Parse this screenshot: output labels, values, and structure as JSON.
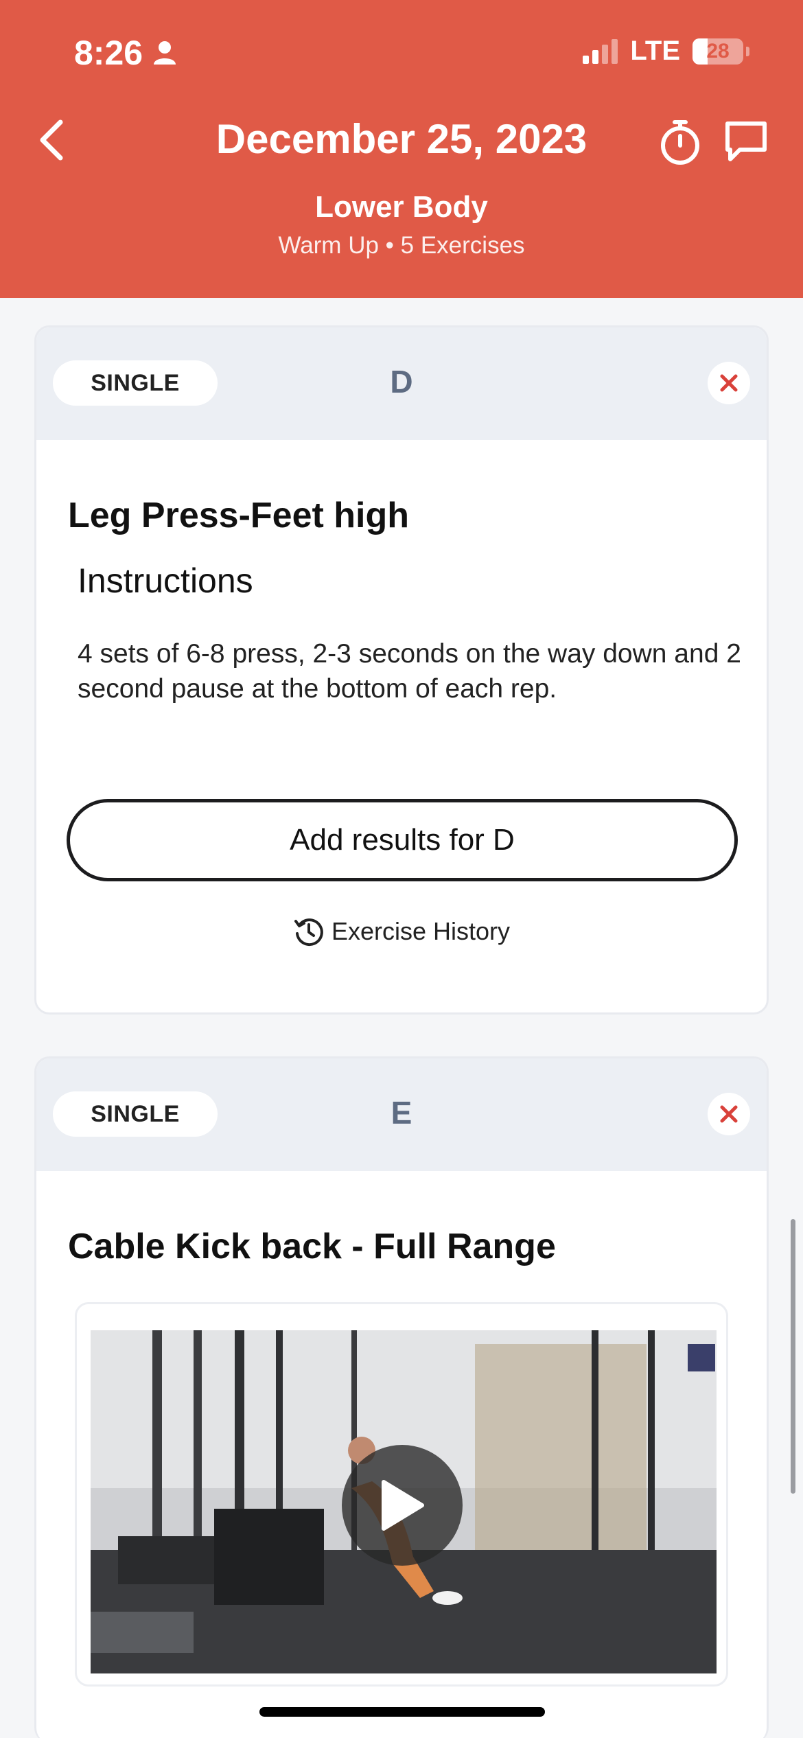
{
  "status_bar": {
    "time": "8:26",
    "network": "LTE",
    "battery": "28"
  },
  "header": {
    "title": "December 25, 2023",
    "workout_name": "Lower Body",
    "workout_meta": "Warm Up • 5 Exercises",
    "accent_color": "#e05a47"
  },
  "cards": [
    {
      "type_label": "SINGLE",
      "letter": "D",
      "exercise_title": "Leg Press-Feet high",
      "instructions_heading": "Instructions",
      "instructions_text": "4 sets of 6-8 press, 2-3 seconds on the way down and 2 second pause at the bottom of each rep.",
      "results_button": "Add results for D",
      "history_link": "Exercise History"
    },
    {
      "type_label": "SINGLE",
      "letter": "E",
      "exercise_title": "Cable Kick back - Full Range"
    }
  ],
  "icons": {
    "back": "chevron-left-icon",
    "timer": "stopwatch-icon",
    "chat": "chat-bubble-icon",
    "close": "close-icon",
    "history": "history-icon",
    "play": "play-icon"
  }
}
